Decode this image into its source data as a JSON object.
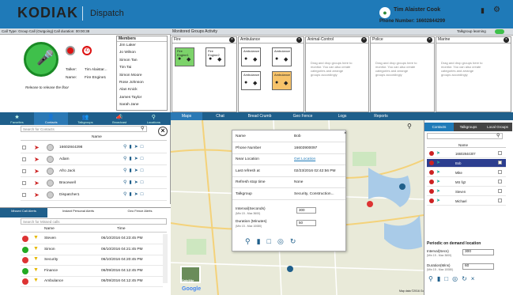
{
  "header": {
    "logo": "KODIAK",
    "app": "Dispatch",
    "user": "Tim Alaister Cook",
    "phone": "Phone Number: 16602844299"
  },
  "call": {
    "type": "Call Type: Group Call (Outgoing)",
    "duration": "Call duration: 00:00:38",
    "hint": "Release to release the floor",
    "talker_label": "Talker:",
    "talker": "Tim Alaistar...",
    "name_label": "Name:",
    "name": "Fire Engine1"
  },
  "members": {
    "title": "Members",
    "items": [
      "Jim Laker",
      "Jo Wilson",
      "Simon Tan",
      "Tim Tai",
      "Simon Moore",
      "Rose Johnson",
      "Alan Knick",
      "James Taylor",
      "Sarah Jane"
    ]
  },
  "left_tabs": [
    "Favorites",
    "Contacts",
    "Talkgroups",
    "Broadcast",
    "Locations"
  ],
  "contacts": {
    "search_placeholder": "Search for Contacts",
    "col_name": "Name",
    "rows": [
      "16602844298",
      "Adam",
      "Afro Jack",
      "Bracewell",
      "Dispatcher1"
    ]
  },
  "alert_tabs": [
    "Missed Call Alerts",
    "Instant Personal Alerts",
    "Geo Fence Alerts"
  ],
  "alerts": {
    "search_placeholder": "Search for Missed calls",
    "col_name": "Name",
    "col_time": "Time",
    "rows": [
      {
        "name": "Steven",
        "time": "06/10/2016 04:23:45 PM",
        "color": "#d33"
      },
      {
        "name": "Simon",
        "time": "06/10/2016 04:21:45 PM",
        "color": "#2a2"
      },
      {
        "name": "Security",
        "time": "06/10/2016 04:20:45 PM",
        "color": "#d33"
      },
      {
        "name": "Finance",
        "time": "06/09/2016 04:12:45 PM",
        "color": "#2a2"
      },
      {
        "name": "Ambulance",
        "time": "06/09/2016 04:12:45 PM",
        "color": "#d33"
      }
    ]
  },
  "groups": {
    "title": "Monitored Groups Activity",
    "talkgroup_learning": "Talkgroup learning",
    "columns": [
      {
        "name": "Fire",
        "cards": [
          {
            "name": "Fire Engine1",
            "color": "#7cd36a"
          },
          {
            "name": "Fire Engine2",
            "color": "#fff"
          }
        ]
      },
      {
        "name": "Ambulance",
        "cards": [
          {
            "name": "Ambulance",
            "color": "#fff"
          },
          {
            "name": "Ambulance",
            "color": "#fff"
          },
          {
            "name": "Ambulance",
            "color": "#fff"
          },
          {
            "name": "Ambulance",
            "color": "#f7c36a"
          }
        ]
      },
      {
        "name": "Animal-Control",
        "cards": []
      },
      {
        "name": "Police",
        "cards": []
      },
      {
        "name": "Marine",
        "cards": []
      }
    ],
    "drop_hint": "Drag and drop groups here to monitor. You can also create categories and arrange groups accordingly"
  },
  "map_tabs": [
    "Maps",
    "Chat",
    "Bread Crumb",
    "Geo Fence",
    "Logs",
    "Reports"
  ],
  "popup": {
    "rows": [
      {
        "label": "Name",
        "value": "Bob"
      },
      {
        "label": "Phone Number",
        "value": "16603900097"
      },
      {
        "label": "Near Location",
        "value": "Get Location"
      },
      {
        "label": "Last refresh at",
        "value": "02/23/2016 02:42:56 PM"
      },
      {
        "label": "Refresh stop time",
        "value": "None"
      },
      {
        "label": "Talkgroup",
        "value": "Security, Construction..."
      }
    ],
    "interval_label": "Interval(Seconds)",
    "interval_sub": "(Min 15 - Max 3600)",
    "interval_val": "300",
    "duration_label": "Duration (Minutes)",
    "duration_sub": "(Min 15 - Max 10080)",
    "duration_val": "50"
  },
  "map": {
    "satellite": "Satellite",
    "google": "Google",
    "terms": "Map data ©2016 Google   Terms of Use   Report a map error"
  },
  "right_tabs": [
    "Contacts",
    "Talkgroups",
    "Local Groups"
  ],
  "right_list": {
    "col_name": "Name",
    "rows": [
      {
        "name": "16602844307",
        "sel": false
      },
      {
        "name": "Bob",
        "sel": true
      },
      {
        "name": "Mike",
        "sel": false
      },
      {
        "name": "MS fq2",
        "sel": false
      },
      {
        "name": "Steven",
        "sel": false
      },
      {
        "name": "Michael",
        "sel": false
      }
    ]
  },
  "periodic": {
    "title": "Periodic on demand location",
    "interval_label": "Interval(Secs)",
    "interval_sub": "(Min 15 - Max 3600)",
    "interval_val": "300",
    "duration_label": "Duration(Mins)",
    "duration_sub": "(Min 15 - Max 10080)",
    "duration_val": "60"
  }
}
